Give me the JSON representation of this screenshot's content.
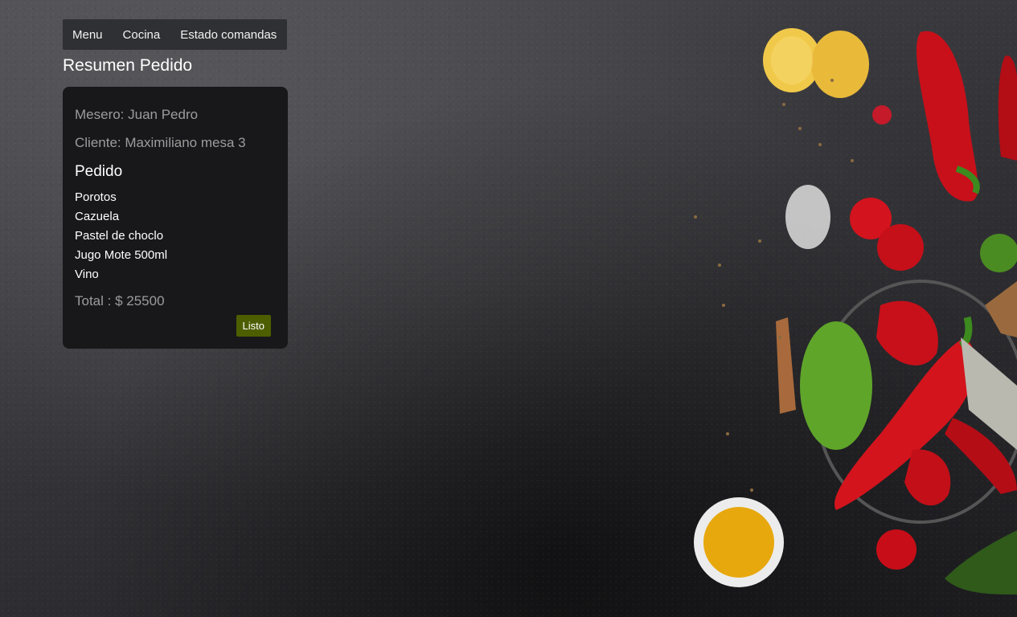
{
  "nav": {
    "items": [
      "Menu",
      "Cocina",
      "Estado comandas"
    ]
  },
  "page": {
    "title": "Resumen Pedido"
  },
  "order": {
    "mesero": "Mesero: Juan Pedro",
    "cliente": "Cliente: Maximiliano mesa 3",
    "pedido_heading": "Pedido",
    "items": [
      "Porotos",
      "Cazuela",
      "Pastel de choclo",
      "Jugo Mote 500ml",
      "Vino"
    ],
    "total": "Total : $ 25500",
    "button_label": "Listo"
  },
  "colors": {
    "nav_bg": "#2e3033",
    "card_bg": "#18181a",
    "button_bg": "#4d5e00",
    "muted_text": "#9c9c9c"
  }
}
